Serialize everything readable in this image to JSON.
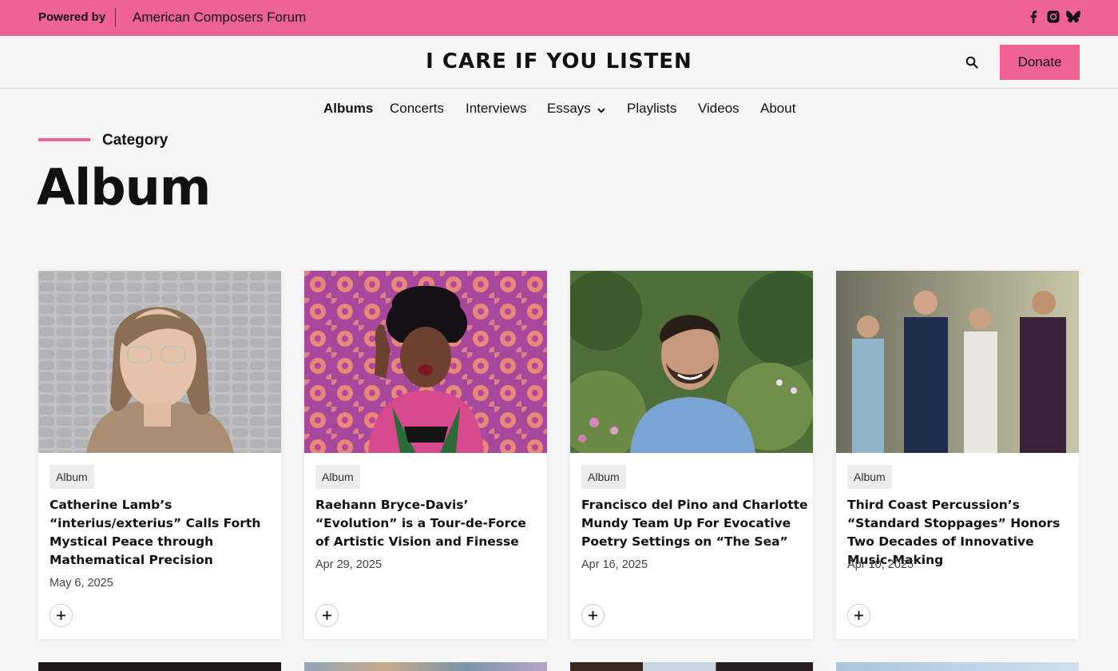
{
  "topbar": {
    "powered_by": "Powered by",
    "forum": "American Composers Forum",
    "social_icons": [
      "facebook-icon",
      "instagram-icon",
      "bluesky-icon"
    ],
    "bg_color": "#ee6296"
  },
  "header": {
    "site_title": "I CARE IF YOU LISTEN",
    "donate_label": "Donate",
    "search_icon": "search-icon"
  },
  "nav": {
    "items": [
      {
        "label": "Albums",
        "active": true
      },
      {
        "label": "Concerts"
      },
      {
        "label": "Interviews"
      },
      {
        "label": "Essays",
        "has_dropdown": true
      },
      {
        "label": "Playlists"
      },
      {
        "label": "Videos"
      },
      {
        "label": "About"
      }
    ]
  },
  "page": {
    "category_label": "Category",
    "title": "Album"
  },
  "cards": [
    {
      "tag": "Album",
      "title": "Catherine Lamb’s “interius/exterius” Calls Forth Mystical Peace through Mathematical Precision",
      "date": "May 6, 2025"
    },
    {
      "tag": "Album",
      "title": "Raehann Bryce-Davis’ “Evolution” is a Tour-de-Force of Artistic Vision and Finesse",
      "date": "Apr 29, 2025"
    },
    {
      "tag": "Album",
      "title": "Francisco del Pino and Charlotte Mundy Team Up For Evocative Poetry Settings on “The Sea”",
      "date": "Apr 16, 2025"
    },
    {
      "tag": "Album",
      "title": "Third Coast Percussion’s “Standard Stoppages” Honors Two Decades of Innovative Music-Making",
      "date": "Apr 10, 2025"
    }
  ],
  "colors": {
    "accent": "#ee6296",
    "background": "#f6f6f6"
  }
}
